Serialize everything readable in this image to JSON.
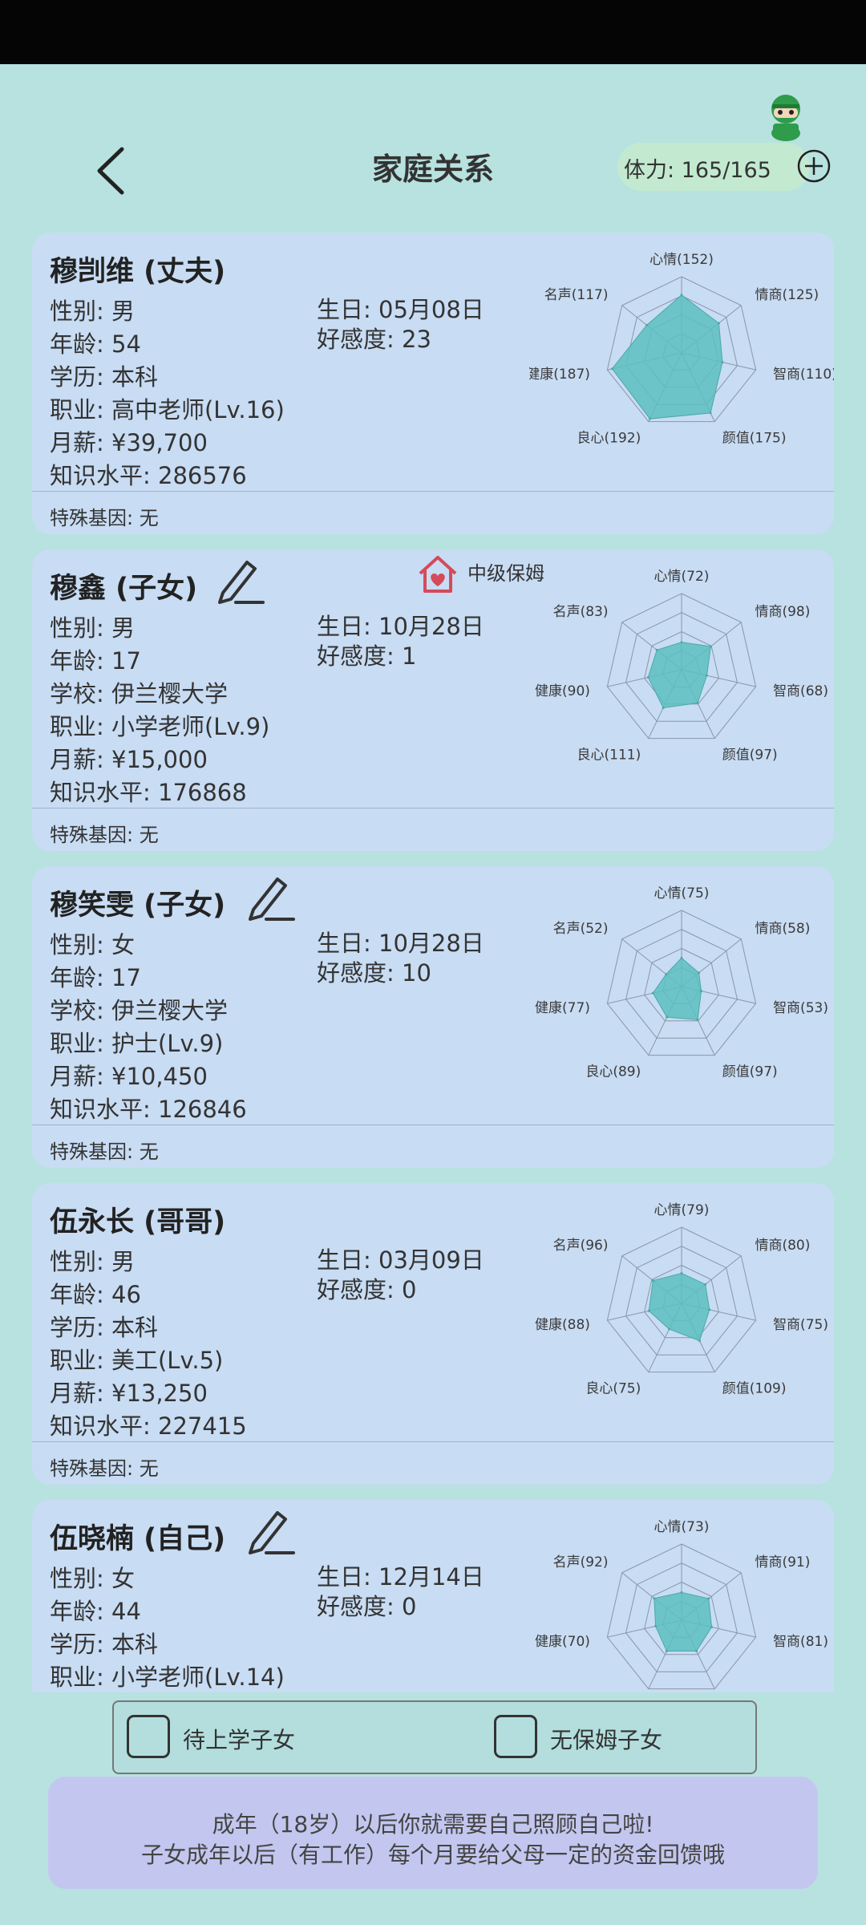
{
  "header": {
    "title": "家庭关系",
    "stamina_text": "体力: 165/165"
  },
  "colors": {
    "background": "#b7e2df",
    "card": "#c8dcf3",
    "radar_fill": "#5cbfbf",
    "notice": "#c3c7ef"
  },
  "members": [
    {
      "name": "穆剀维 (丈夫)",
      "editable": false,
      "left": [
        "性别: 男",
        "年龄: 54",
        "学历: 本科",
        "职业: 高中老师(Lv.16)",
        "月薪: ¥39,700",
        "知识水平: 286576"
      ],
      "birthday": "生日: 05月08日",
      "favor": "好感度: 23",
      "gene": "特殊基因: 无",
      "radar": {
        "labels": [
          "心情(152)",
          "情商(125)",
          "智商(110)",
          "颜值(175)",
          "良心(192)",
          "健康(187)",
          "名声(117)"
        ],
        "values": [
          152,
          125,
          110,
          175,
          192,
          187,
          117
        ],
        "max": 200
      }
    },
    {
      "name": "穆鑫 (子女)",
      "editable": true,
      "badge": {
        "icon": "house-heart-icon",
        "text": "中级保姆"
      },
      "left": [
        "性别: 男",
        "年龄: 17",
        "学校: 伊兰樱大学",
        "职业: 小学老师(Lv.9)",
        "月薪: ¥15,000",
        "知识水平: 176868"
      ],
      "birthday": "生日: 10月28日",
      "favor": "好感度: 1",
      "gene": "特殊基因: 无",
      "radar": {
        "labels": [
          "心情(72)",
          "情商(98)",
          "智商(68)",
          "颜值(97)",
          "良心(111)",
          "健康(90)",
          "名声(83)"
        ],
        "values": [
          72,
          98,
          68,
          97,
          111,
          90,
          83
        ],
        "max": 200
      }
    },
    {
      "name": "穆笑雯 (子女)",
      "editable": true,
      "left": [
        "性别: 女",
        "年龄: 17",
        "学校: 伊兰樱大学",
        "职业: 护士(Lv.9)",
        "月薪: ¥10,450",
        "知识水平: 126846"
      ],
      "birthday": "生日: 10月28日",
      "favor": "好感度: 10",
      "gene": "特殊基因: 无",
      "radar": {
        "labels": [
          "心情(75)",
          "情商(58)",
          "智商(53)",
          "颜值(97)",
          "良心(89)",
          "健康(77)",
          "名声(52)"
        ],
        "values": [
          75,
          58,
          53,
          97,
          89,
          77,
          52
        ],
        "max": 200
      }
    },
    {
      "name": "伍永长 (哥哥)",
      "editable": false,
      "left": [
        "性别: 男",
        "年龄: 46",
        "学历: 本科",
        "职业: 美工(Lv.5)",
        "月薪: ¥13,250",
        "知识水平: 227415"
      ],
      "birthday": "生日: 03月09日",
      "favor": "好感度: 0",
      "gene": "特殊基因: 无",
      "radar": {
        "labels": [
          "心情(79)",
          "情商(80)",
          "智商(75)",
          "颜值(109)",
          "良心(75)",
          "健康(88)",
          "名声(96)"
        ],
        "values": [
          79,
          80,
          75,
          109,
          75,
          88,
          96
        ],
        "max": 200
      }
    },
    {
      "name": "伍晓楠 (自己)",
      "editable": true,
      "left": [
        "性别: 女",
        "年龄: 44",
        "学历: 本科",
        "职业: 小学老师(Lv.14)"
      ],
      "birthday": "生日: 12月14日",
      "favor": "好感度: 0",
      "gene": "",
      "radar": {
        "labels": [
          "心情(73)",
          "情商(91)",
          "智商(81)",
          "",
          "",
          "健康(70)",
          "名声(92)"
        ],
        "values": [
          73,
          91,
          81,
          90,
          90,
          70,
          92
        ],
        "max": 200
      }
    }
  ],
  "filters": {
    "school": "待上学子女",
    "no_nanny": "无保姆子女"
  },
  "notice": {
    "line1": "成年（18岁）以后你就需要自己照顾自己啦!",
    "line2": "子女成年以后（有工作）每个月要给父母一定的资金回馈哦"
  }
}
